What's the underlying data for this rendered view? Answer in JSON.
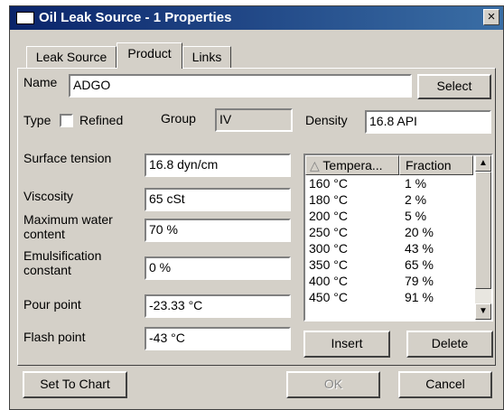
{
  "window": {
    "title": "Oil Leak Source - 1 Properties",
    "close_glyph": "×"
  },
  "tabs": [
    {
      "label": "Leak Source",
      "active": false
    },
    {
      "label": "Product",
      "active": true
    },
    {
      "label": "Links",
      "active": false
    }
  ],
  "form": {
    "name_label": "Name",
    "name_value": "ADGO",
    "select_label": "Select",
    "type_label": "Type",
    "refined_label": "Refined",
    "refined_checked": false,
    "group_label": "Group",
    "group_value": "IV",
    "density_label": "Density",
    "density_value": "16.8 API",
    "surface_tension_label": "Surface tension",
    "surface_tension_value": "16.8 dyn/cm",
    "viscosity_label": "Viscosity",
    "viscosity_value": "65 cSt",
    "max_water_label_1": "Maximum water",
    "max_water_label_2": "content",
    "max_water_value": "70 %",
    "emulsification_label_1": "Emulsification",
    "emulsification_label_2": "constant",
    "emulsification_value": "0 %",
    "pour_point_label": "Pour point",
    "pour_point_value": "-23.33 °C",
    "flash_point_label": "Flash point",
    "flash_point_value": "-43 °C"
  },
  "distillation_table": {
    "headers": [
      "Tempera...",
      "Fraction"
    ],
    "sort_glyph": "△",
    "rows": [
      {
        "temp": "160 °C",
        "fraction": "1 %"
      },
      {
        "temp": "180 °C",
        "fraction": "2 %"
      },
      {
        "temp": "200 °C",
        "fraction": "5 %"
      },
      {
        "temp": "250 °C",
        "fraction": "20 %"
      },
      {
        "temp": "300 °C",
        "fraction": "43 %"
      },
      {
        "temp": "350 °C",
        "fraction": "65 %"
      },
      {
        "temp": "400 °C",
        "fraction": "79 %"
      },
      {
        "temp": "450 °C",
        "fraction": "91 %"
      }
    ],
    "scroll_up_glyph": "▲",
    "scroll_down_glyph": "▼"
  },
  "table_buttons": {
    "insert": "Insert",
    "delete": "Delete"
  },
  "footer": {
    "set_to_chart": "Set To Chart",
    "ok": "OK",
    "ok_enabled": false,
    "cancel": "Cancel"
  }
}
